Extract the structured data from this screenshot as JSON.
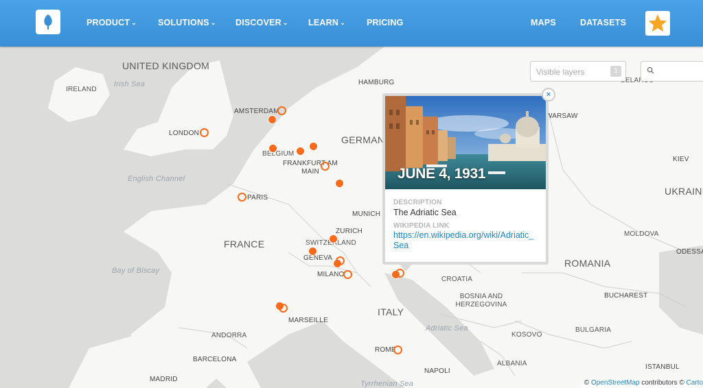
{
  "header": {
    "nav": [
      {
        "label": "PRODUCT",
        "chevron": true
      },
      {
        "label": "SOLUTIONS",
        "chevron": true
      },
      {
        "label": "DISCOVER",
        "chevron": true
      },
      {
        "label": "LEARN",
        "chevron": true
      },
      {
        "label": "PRICING",
        "chevron": false
      }
    ],
    "right_nav": [
      {
        "label": "MAPS"
      },
      {
        "label": "DATASETS"
      }
    ],
    "chevron_glyph": "⌄",
    "star_icon": "star-icon",
    "logo_icon": "carto-logo-icon"
  },
  "map_controls": {
    "layers_placeholder": "Visible layers",
    "layers_count": "1",
    "search_icon": "search-icon"
  },
  "map": {
    "countries": [
      "UNITED KINGDOM",
      "IRELAND",
      "GERMANY",
      "BELGIUM",
      "FRANCE",
      "SWITZERLAND",
      "ITALY",
      "CROATIA",
      "BOSNIA AND HERZEGOVINA",
      "ROMANIA",
      "MOLDOVA",
      "UKRAINE",
      "BULGARIA",
      "KOSOVO",
      "ALBANIA",
      "ANDORRA",
      "BELARUS"
    ],
    "cities": [
      "AMSTERDAM",
      "LONDON",
      "HAMBURG",
      "FRANKFURT AM MAIN",
      "PARIS",
      "MUNICH",
      "ZURICH",
      "GENEVA",
      "MILANO",
      "MARSEILLE",
      "BARCELONA",
      "MADRID",
      "ROME",
      "NAPOLI",
      "BUCHAREST",
      "ISTANBUL",
      "ODESSA",
      "KIEV",
      "WARSAW"
    ],
    "seas": [
      "Irish Sea",
      "English Channel",
      "Bay of Biscay",
      "Adriatic Sea",
      "Tyrrhenian Sea"
    ]
  },
  "popup": {
    "date": "JUNE 4, 1931",
    "description_header": "DESCRIPTION",
    "description": "The Adriatic Sea",
    "wiki_header": "WIKIPEDIA LINK",
    "wiki_link": "https://en.wikipedia.org/wiki/Adriatic_Sea",
    "close_glyph": "×"
  },
  "attribution": {
    "prefix": "© ",
    "osm": "OpenStreetMap",
    "middle": " contributors © ",
    "carto": "Carto"
  },
  "colors": {
    "header": "#3a8fd6",
    "marker": "#f96a1a",
    "star": "#f5a623",
    "link": "#1785c2"
  }
}
